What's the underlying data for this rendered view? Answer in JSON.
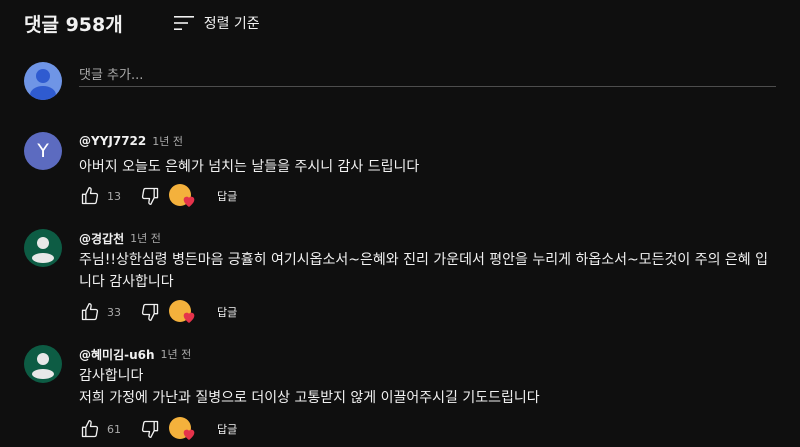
{
  "header": {
    "count_label": "댓글 958개",
    "sort_label": "정렬 기준",
    "sort_icon": "sort-icon"
  },
  "add_comment": {
    "placeholder": "댓글 추가..."
  },
  "colors": {
    "background": "#0f0f0f",
    "text": "#f1f1f1",
    "secondary": "#aaaaaa",
    "heart": "#e5334b",
    "letter_avatar": "#5c6bc0",
    "person_avatar": "#0d5c44"
  },
  "comments": [
    {
      "avatar_letter": "Y",
      "author": "@YYJ7722",
      "time": "1년 전",
      "text_lines": [
        "아버지 오늘도 은혜가 넘치는 날들을 주시니 감사 드립니다"
      ],
      "likes": "13",
      "reply_label": "답글"
    },
    {
      "avatar_letter": "",
      "author": "@경갑천",
      "time": "1년 전",
      "text_lines": [
        "주님!!상한심령 병든마음 긍휼히 여기시옵소서~은혜와 진리 가운데서 평안을 누리게 하옵소서~모든것이 주의 은혜 입",
        "니다 감사합니다"
      ],
      "likes": "33",
      "reply_label": "답글"
    },
    {
      "avatar_letter": "",
      "author": "@혜미김-u6h",
      "time": "1년 전",
      "text_lines": [
        "감사합니다",
        "저희 가정에 가난과 질병으로 더이상 고통받지 않게 이끌어주시길 기도드립니다"
      ],
      "likes": "61",
      "reply_label": "답글"
    }
  ]
}
